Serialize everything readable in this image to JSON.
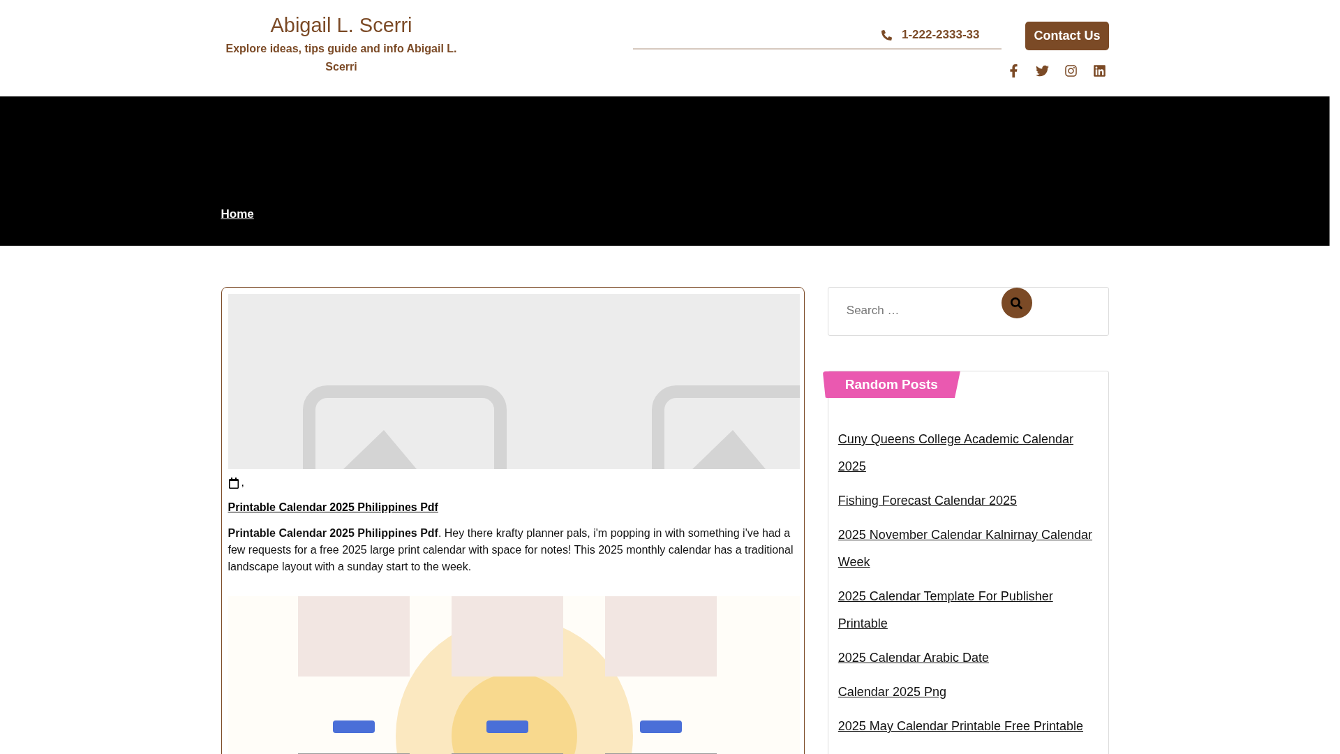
{
  "site": {
    "title": "Abigail L. Scerri",
    "tagline": "Explore ideas, tips guide and info Abigail L. Scerri"
  },
  "header": {
    "phone": "1-222-2333-33",
    "contact_button": "Contact Us"
  },
  "breadcrumb": {
    "label": "Home"
  },
  "post": {
    "date_separator": ",",
    "title": "Printable Calendar 2025 Philippines Pdf",
    "body": "**Printable Calendar 2025 Philippines Pdf**. Hey there krafty planner pals, i'm popping in with something i've had a few requests for a free 2025 large print calendar with space for notes! This 2025 monthly calendar has a traditional landscape layout with a sunday start to the week."
  },
  "search": {
    "placeholder": "Search …"
  },
  "random_posts": {
    "title": "Random Posts",
    "items": [
      {
        "label": "Cuny Queens College Academic Calendar 2025"
      },
      {
        "label": "Fishing Forecast Calendar 2025"
      },
      {
        "label": "2025 November Calendar Kalnirnay Calendar Week"
      },
      {
        "label": "2025 Calendar Template For Publisher Printable"
      },
      {
        "label": "2025 Calendar Arabic Date"
      },
      {
        "label": "Calendar 2025 Png"
      },
      {
        "label": "2025 May Calendar Printable Free Printable"
      }
    ]
  }
}
